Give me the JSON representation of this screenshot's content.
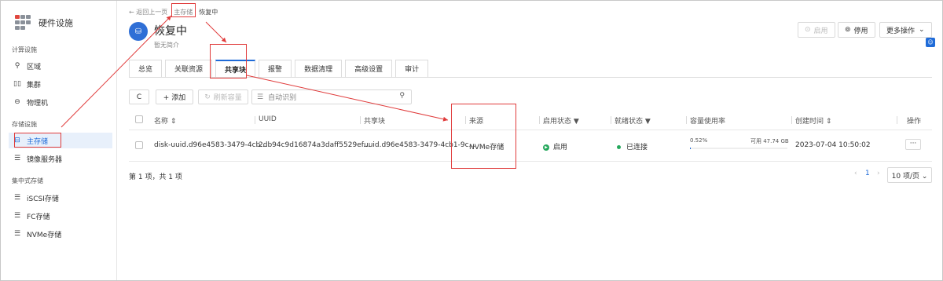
{
  "sidebar": {
    "brand_title": "硬件设施",
    "groups": [
      {
        "title": "计算设施"
      },
      {
        "title": "存储设施"
      },
      {
        "title": "集中式存储"
      }
    ],
    "items": [
      {
        "label": "区域",
        "icon": "location-icon"
      },
      {
        "label": "集群",
        "icon": "cluster-icon"
      },
      {
        "label": "物理机",
        "icon": "host-icon"
      },
      {
        "label": "主存储",
        "icon": "primary-storage-icon",
        "active": true
      },
      {
        "label": "镜像服务器",
        "icon": "image-server-icon"
      },
      {
        "label": "iSCSI存储",
        "icon": "storage-icon"
      },
      {
        "label": "FC存储",
        "icon": "storage-icon"
      },
      {
        "label": "NVMe存储",
        "icon": "storage-icon"
      }
    ]
  },
  "breadcrumb": {
    "back": "← 返回上一页",
    "parent": "主存储",
    "current": "恢复中"
  },
  "header": {
    "title": "恢复中",
    "subtitle": "暂无简介",
    "buttons": {
      "enable": "启用",
      "disable": "停用",
      "more": "更多操作"
    }
  },
  "tabs": [
    {
      "label": "总览"
    },
    {
      "label": "关联资源"
    },
    {
      "label": "共享块",
      "active": true
    },
    {
      "label": "报警"
    },
    {
      "label": "数据清理"
    },
    {
      "label": "高级设置"
    },
    {
      "label": "审计"
    }
  ],
  "toolbar": {
    "refresh_icon": "C",
    "add": "+ 添加",
    "refresh_capacity": "刷新容量",
    "search_placeholder": "自动识别"
  },
  "table": {
    "columns": {
      "name": "名称",
      "uuid": "UUID",
      "shared_block": "共享块",
      "source": "来源",
      "enable_state": "启用状态",
      "ready_state": "就绪状态",
      "capacity": "容量使用率",
      "created": "创建时间",
      "actions": "操作"
    },
    "rows": [
      {
        "name": "disk-uuid.d96e4583-3479-4cb...",
        "uuid": "2db94c9d16874a3daff5529ef...",
        "shared_block": "uuid.d96e4583-3479-4cb1-9c...",
        "source": "NVMe存储",
        "enable_state": "启用",
        "ready_state": "已连接",
        "usage_percent": "0.52%",
        "usage_fraction": 0.0052,
        "free": "可用 47.74 GB",
        "created": "2023-07-04 10:50:02",
        "more": "···"
      }
    ]
  },
  "footer": {
    "count": "第 1 项，共 1 项",
    "prev": "‹",
    "page": "1",
    "next": "›",
    "page_size": "10 项/页 ⌄"
  },
  "colors": {
    "accent": "#1f6bd8",
    "annotation": "#e03b3b",
    "success": "#25a85c"
  }
}
